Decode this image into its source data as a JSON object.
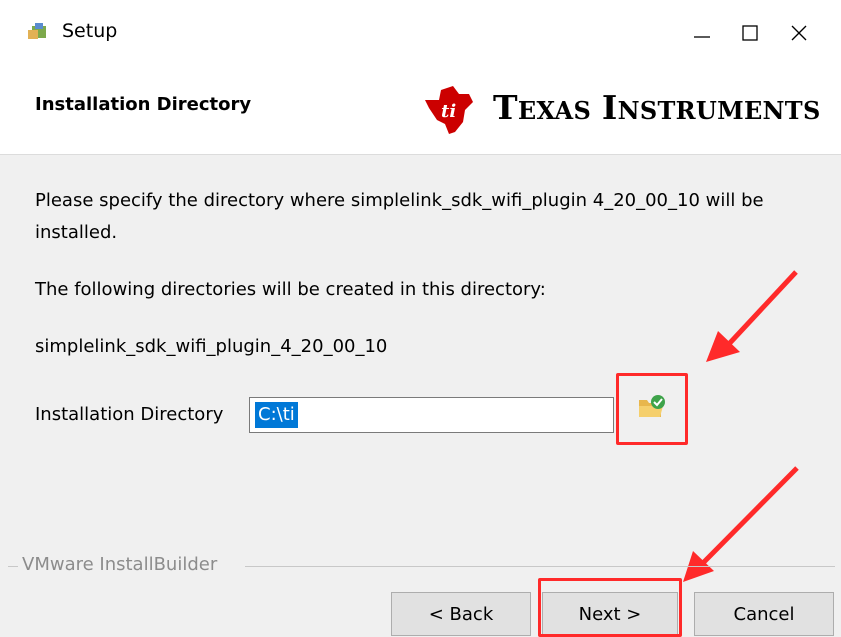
{
  "window": {
    "title": "Setup",
    "minimize_icon": "minimize-icon",
    "maximize_icon": "maximize-icon",
    "close_icon": "close-icon"
  },
  "header": {
    "title": "Installation Directory",
    "logo_text_word1_cap": "T",
    "logo_text_word1_rest": "EXAS",
    "logo_text_word2_cap": "I",
    "logo_text_word2_rest": "NSTRUMENTS",
    "logo_color": "#cc0000"
  },
  "body": {
    "intro_line1": "Please specify the directory where simplelink_sdk_wifi_plugin 4_20_00_10 will be",
    "intro_line2": "installed.",
    "dirs_note": "The following directories will be created in this directory:",
    "dir_name": "simplelink_sdk_wifi_plugin_4_20_00_10",
    "dir_label": "Installation Directory",
    "dir_value": "C:\\ti"
  },
  "footer": {
    "brand": "VMware InstallBuilder",
    "back_label": "< Back",
    "next_label": "Next >",
    "cancel_label": "Cancel"
  },
  "annotations": {
    "highlight_color": "#ff2a2a"
  }
}
